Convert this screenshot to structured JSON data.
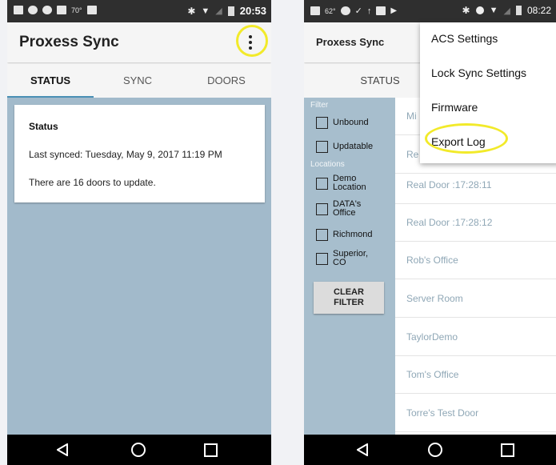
{
  "left_screen": {
    "statusbar": {
      "temperature": "70°",
      "time": "20:53"
    },
    "app_title": "Proxess Sync",
    "tabs": [
      "STATUS",
      "SYNC",
      "DOORS"
    ],
    "status_card": {
      "title": "Status",
      "last_synced": "Last synced: Tuesday, May 9, 2017 11:19 PM",
      "doors_to_update": "There are 16 doors to update."
    }
  },
  "right_screen": {
    "statusbar": {
      "temperature": "62°",
      "time": "08:22"
    },
    "app_title": "Proxess Sync",
    "tab_visible": "STATUS",
    "filter": {
      "heading": "Filter",
      "options": [
        "Unbound",
        "Updatable"
      ],
      "locations_heading": "Locations",
      "locations": [
        "Demo Location",
        "DATA's Office",
        "Richmond",
        "Superior, CO"
      ],
      "clear_button": [
        "CLEAR",
        "FILTER"
      ]
    },
    "doors": [
      "Mi",
      "Re",
      "Real Door :17:28:11",
      "Real Door :17:28:12",
      "Rob's Office",
      "Server Room",
      "TaylorDemo",
      "Tom's Office",
      "Torre's Test Door"
    ],
    "overflow_menu": [
      "ACS Settings",
      "Lock Sync Settings",
      "Firmware",
      "Export Log"
    ]
  },
  "colors": {
    "accent": "#4a8fb5",
    "content_bg": "#a2bacb",
    "highlight": "#f2ea2a",
    "statusbar": "#2f2f2f"
  }
}
